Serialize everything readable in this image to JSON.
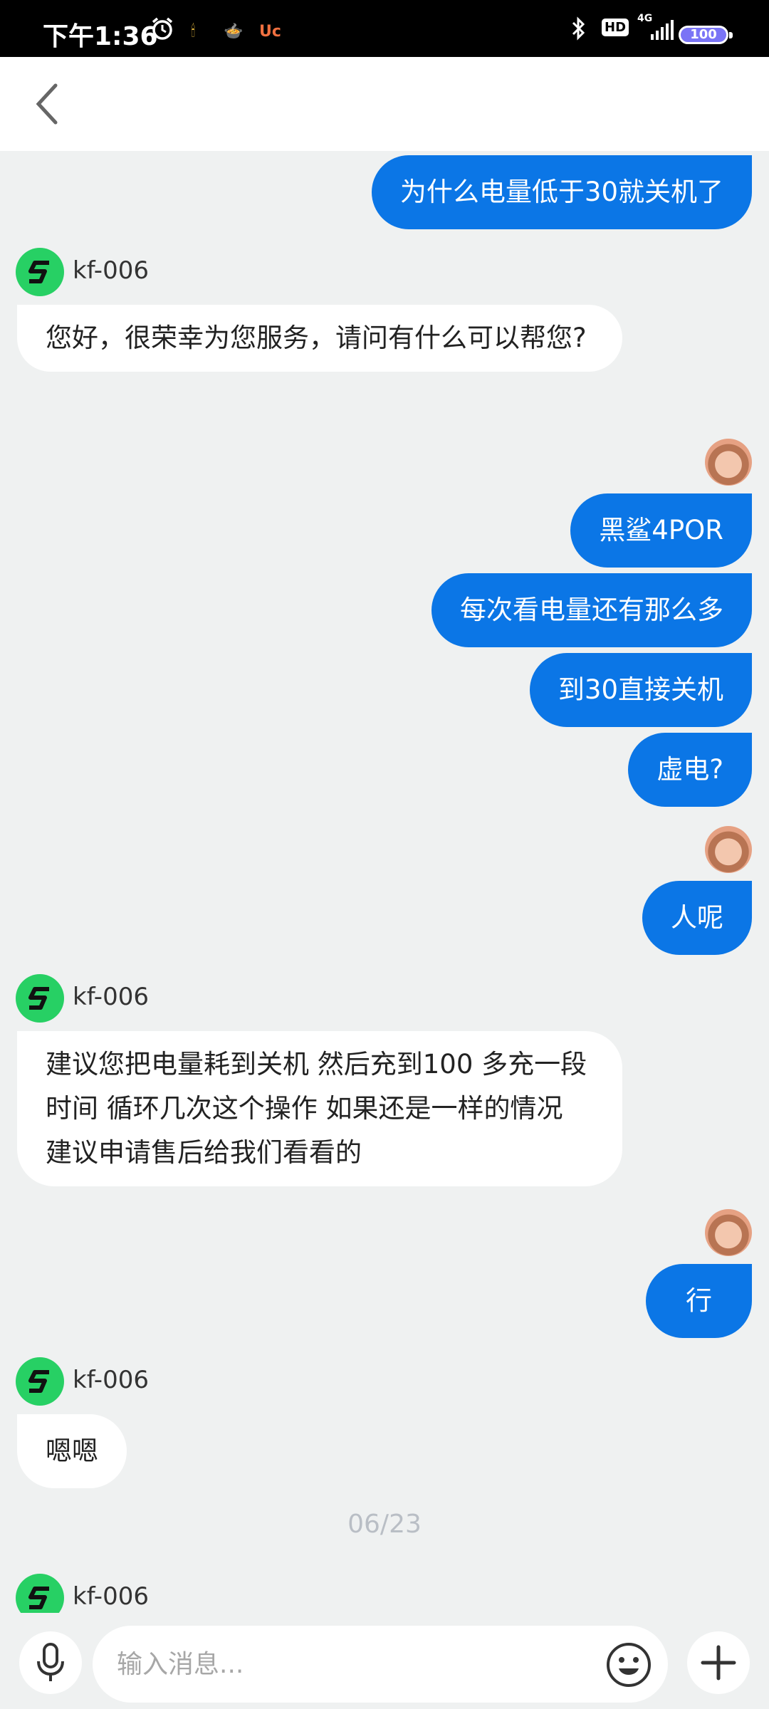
{
  "status_bar": {
    "time": "下午1:36",
    "apps": [
      "🕯",
      "🍲",
      "Uc"
    ],
    "hd_label": "HD",
    "network": "4G",
    "battery": "100"
  },
  "agent_name": "kf-006",
  "chat": {
    "msg1": "为什么电量低于30就关机了",
    "msg2": "您好，很荣幸为您服务，请问有什么可以帮您?",
    "msg3": "黑鲨4POR",
    "msg4": "每次看电量还有那么多",
    "msg5": "到30直接关机",
    "msg6": "虚电?",
    "msg7": "人呢",
    "msg8": "建议您把电量耗到关机 然后充到100 多充一段时间 循环几次这个操作 如果还是一样的情况 建议申请售后给我们看看的",
    "msg9": "行",
    "msg10": "嗯嗯",
    "date_separator": "06/23"
  },
  "input": {
    "placeholder": "输入消息..."
  }
}
